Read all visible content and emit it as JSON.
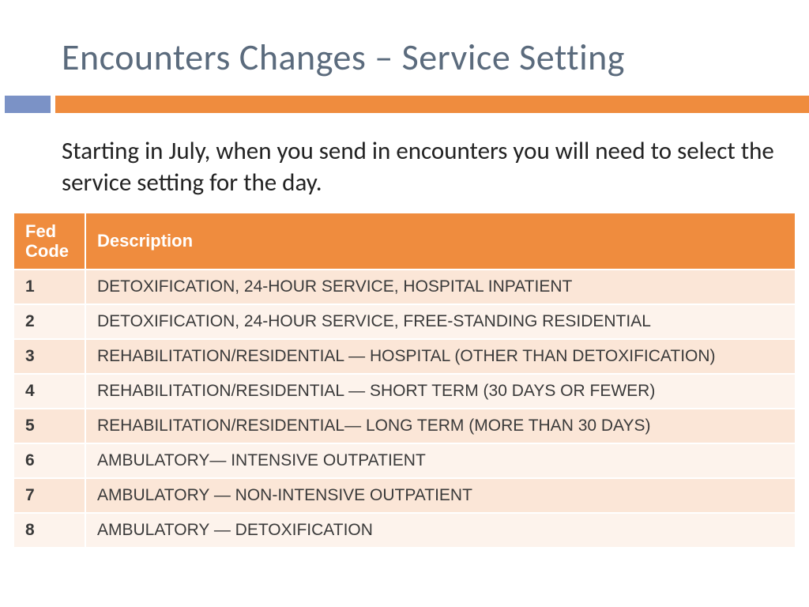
{
  "title": "Encounters Changes – Service Setting",
  "intro": "Starting in July, when you send in encounters you will need to select the service setting for the day.",
  "table": {
    "headers": {
      "code": "Fed Code",
      "desc": "Description"
    },
    "rows": [
      {
        "code": "1",
        "desc": "DETOXIFICATION, 24-HOUR SERVICE, HOSPITAL INPATIENT"
      },
      {
        "code": "2",
        "desc": "DETOXIFICATION, 24-HOUR SERVICE, FREE-STANDING RESIDENTIAL"
      },
      {
        "code": "3",
        "desc": "REHABILITATION/RESIDENTIAL — HOSPITAL (OTHER THAN DETOXIFICATION)"
      },
      {
        "code": "4",
        "desc": "REHABILITATION/RESIDENTIAL — SHORT TERM (30 DAYS OR FEWER)"
      },
      {
        "code": "5",
        "desc": "REHABILITATION/RESIDENTIAL— LONG TERM (MORE THAN 30 DAYS)"
      },
      {
        "code": "6",
        "desc": "AMBULATORY— INTENSIVE OUTPATIENT"
      },
      {
        "code": "7",
        "desc": "AMBULATORY — NON-INTENSIVE OUTPATIENT"
      },
      {
        "code": "8",
        "desc": "AMBULATORY — DETOXIFICATION"
      }
    ]
  }
}
